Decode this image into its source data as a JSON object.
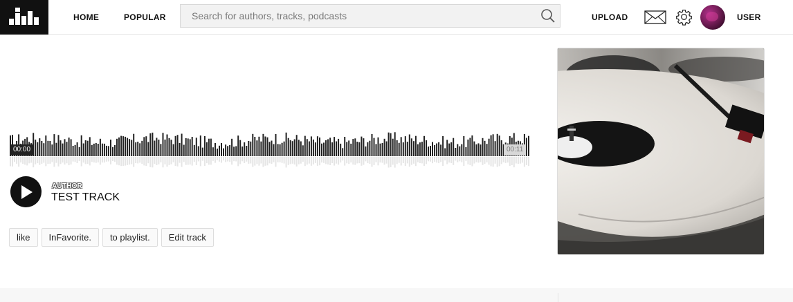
{
  "header": {
    "nav": {
      "home": "HOME",
      "popular": "POPULAR",
      "upload": "UPLOAD",
      "user": "USER"
    },
    "search": {
      "placeholder": "Search for authors, tracks, podcasts",
      "value": ""
    }
  },
  "player": {
    "current_time": "00:00",
    "total_time": "00:11",
    "progress": 0.0,
    "author": "AUTHOR",
    "title": "TEST TRACK"
  },
  "actions": {
    "like": "like",
    "favorite": "InFavorite.",
    "playlist": "to playlist.",
    "edit": "Edit track"
  },
  "colors": {
    "header_bg": "#ffffff",
    "logo_bg": "#111111",
    "wave_bar": "#222222",
    "wave_reflection": "#e5e5e5"
  }
}
